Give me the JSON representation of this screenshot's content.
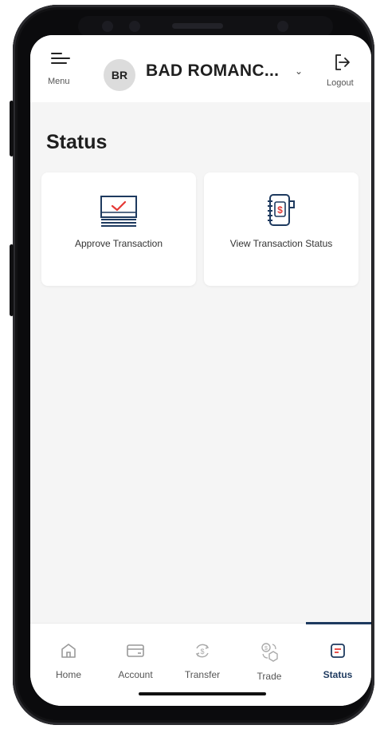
{
  "header": {
    "menu_label": "Menu",
    "avatar_initials": "BR",
    "account_name": "BAD ROMANC...",
    "logout_label": "Logout"
  },
  "page": {
    "title": "Status"
  },
  "cards": [
    {
      "label": "Approve Transaction",
      "icon": "approve-transaction-icon"
    },
    {
      "label": "View Transaction Status",
      "icon": "transaction-status-icon"
    }
  ],
  "bottom_nav": {
    "active": "Status",
    "items": [
      {
        "label": "Home",
        "icon": "home-icon"
      },
      {
        "label": "Account",
        "icon": "card-icon"
      },
      {
        "label": "Transfer",
        "icon": "transfer-icon"
      },
      {
        "label": "Trade",
        "icon": "trade-icon"
      },
      {
        "label": "Status",
        "icon": "status-icon"
      }
    ]
  },
  "colors": {
    "accent": "#1e3a5f",
    "alert_red": "#e53935",
    "background": "#f5f5f5"
  }
}
